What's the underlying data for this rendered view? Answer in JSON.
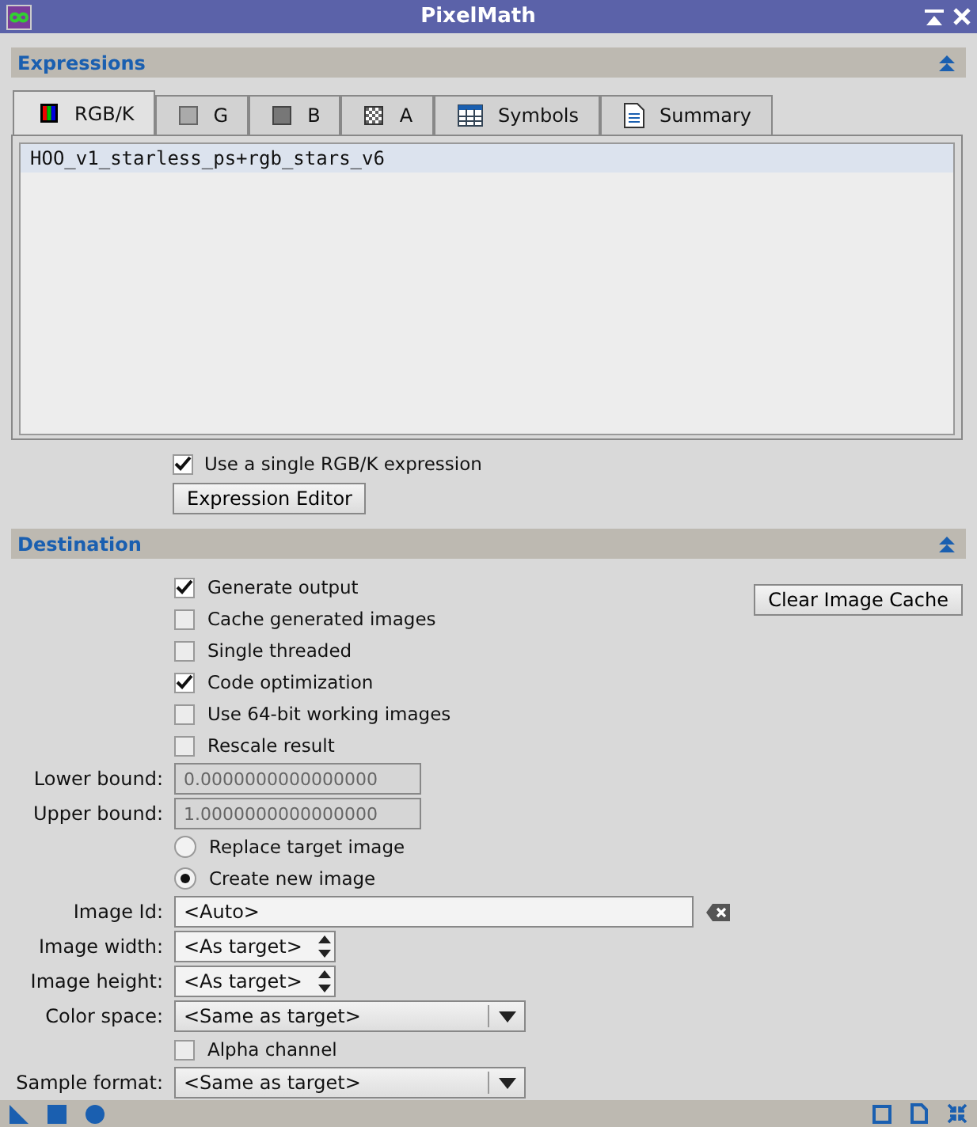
{
  "window": {
    "title": "PixelMath"
  },
  "expressions": {
    "title": "Expressions",
    "tabs": [
      {
        "label": "RGB/K",
        "kind": "rgb",
        "selected": true
      },
      {
        "label": "G",
        "kind": "gray",
        "selected": false
      },
      {
        "label": "B",
        "kind": "dark",
        "selected": false
      },
      {
        "label": "A",
        "kind": "checker",
        "selected": false
      },
      {
        "label": "Symbols",
        "kind": "table",
        "selected": false
      },
      {
        "label": "Summary",
        "kind": "document",
        "selected": false
      }
    ],
    "expression": "HOO_v1_starless_ps+rgb_stars_v6",
    "single_expression": {
      "label": "Use a single RGB/K expression",
      "checked": true
    },
    "editor_button": "Expression Editor"
  },
  "destination": {
    "title": "Destination",
    "options": [
      {
        "label": "Generate output",
        "checked": true
      },
      {
        "label": "Cache generated images",
        "checked": false
      },
      {
        "label": "Single threaded",
        "checked": false
      },
      {
        "label": "Code optimization",
        "checked": true
      },
      {
        "label": "Use 64-bit working images",
        "checked": false
      },
      {
        "label": "Rescale result",
        "checked": false
      }
    ],
    "clear_cache_button": "Clear Image Cache",
    "lower_bound": {
      "label": "Lower bound:",
      "value": "0.0000000000000000",
      "disabled": true
    },
    "upper_bound": {
      "label": "Upper bound:",
      "value": "1.0000000000000000",
      "disabled": true
    },
    "modes": [
      {
        "label": "Replace target image",
        "selected": false
      },
      {
        "label": "Create new image",
        "selected": true
      }
    ],
    "image_id": {
      "label": "Image Id:",
      "value": "<Auto>"
    },
    "image_width": {
      "label": "Image width:",
      "value": "<As target>"
    },
    "image_height": {
      "label": "Image height:",
      "value": "<As target>"
    },
    "color_space": {
      "label": "Color space:",
      "value": "<Same as target>"
    },
    "alpha_channel": {
      "label": "Alpha channel",
      "checked": false
    },
    "sample_format": {
      "label": "Sample format:",
      "value": "<Same as target>"
    }
  }
}
